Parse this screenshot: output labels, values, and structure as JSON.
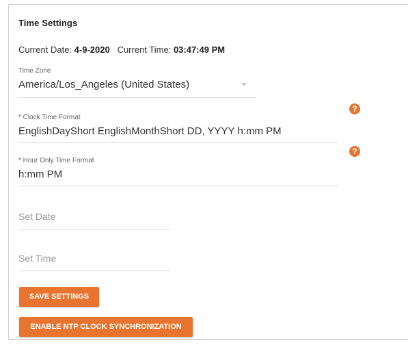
{
  "panel": {
    "title": "Time Settings"
  },
  "current": {
    "date_label": "Current Date:",
    "date_value": "4-9-2020",
    "time_label": "Current Time:",
    "time_value": "03:47:49 PM"
  },
  "time_zone": {
    "label": "Time Zone",
    "value": "America/Los_Angeles (United States)"
  },
  "clock_format": {
    "label": "* Clock Time Format",
    "value": "EnglishDayShort EnglishMonthShort DD, YYYY h:mm PM"
  },
  "hour_format": {
    "label": "* Hour Only Time Format",
    "value": "h:mm PM"
  },
  "set_date": {
    "placeholder": "Set Date"
  },
  "set_time": {
    "placeholder": "Set Time"
  },
  "help": {
    "glyph": "?"
  },
  "buttons": {
    "save": "SAVE SETTINGS",
    "ntp": "ENABLE NTP CLOCK SYNCHRONIZATION"
  },
  "colors": {
    "accent": "#e8742f"
  }
}
